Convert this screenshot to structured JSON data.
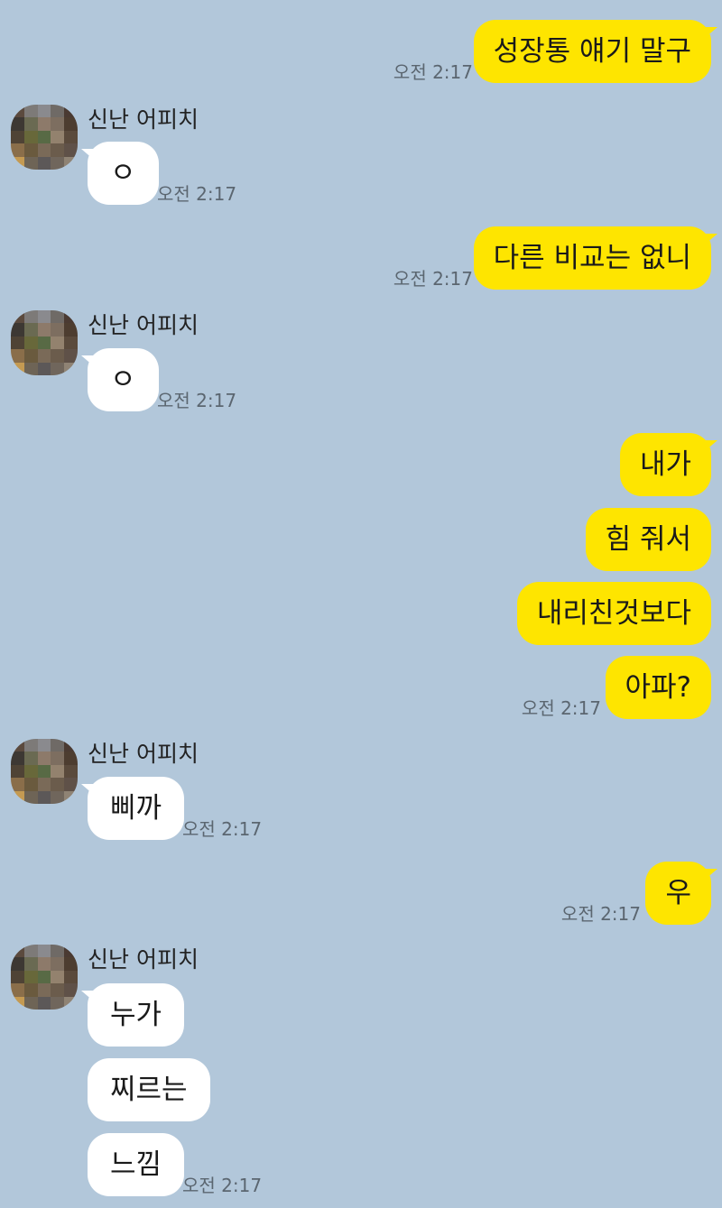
{
  "chat": {
    "timestamp": "오전 2:17",
    "colors": {
      "background": "#b2c7da",
      "outgoing_bubble": "#fee500",
      "incoming_bubble": "#ffffff"
    },
    "messages": [
      {
        "from": "me",
        "text": "성장통 얘기 말구"
      },
      {
        "from": "other",
        "sender": "신난 어피치",
        "text": "ㅇ"
      },
      {
        "from": "me",
        "text": "다른 비교는 없니"
      },
      {
        "from": "other",
        "sender": "신난 어피치",
        "text": "ㅇ"
      },
      {
        "from": "me",
        "text": "내가"
      },
      {
        "from": "me",
        "text": "힘 줘서"
      },
      {
        "from": "me",
        "text": "내리친것보다"
      },
      {
        "from": "me",
        "text": "아파?"
      },
      {
        "from": "other",
        "sender": "신난 어피치",
        "text": "삐까"
      },
      {
        "from": "me",
        "text": "우"
      },
      {
        "from": "other",
        "sender": "신난 어피치",
        "text": "누가"
      },
      {
        "from": "other",
        "sender": "신난 어피치",
        "text": "찌르는"
      },
      {
        "from": "other",
        "sender": "신난 어피치",
        "text": "느낌"
      }
    ]
  }
}
